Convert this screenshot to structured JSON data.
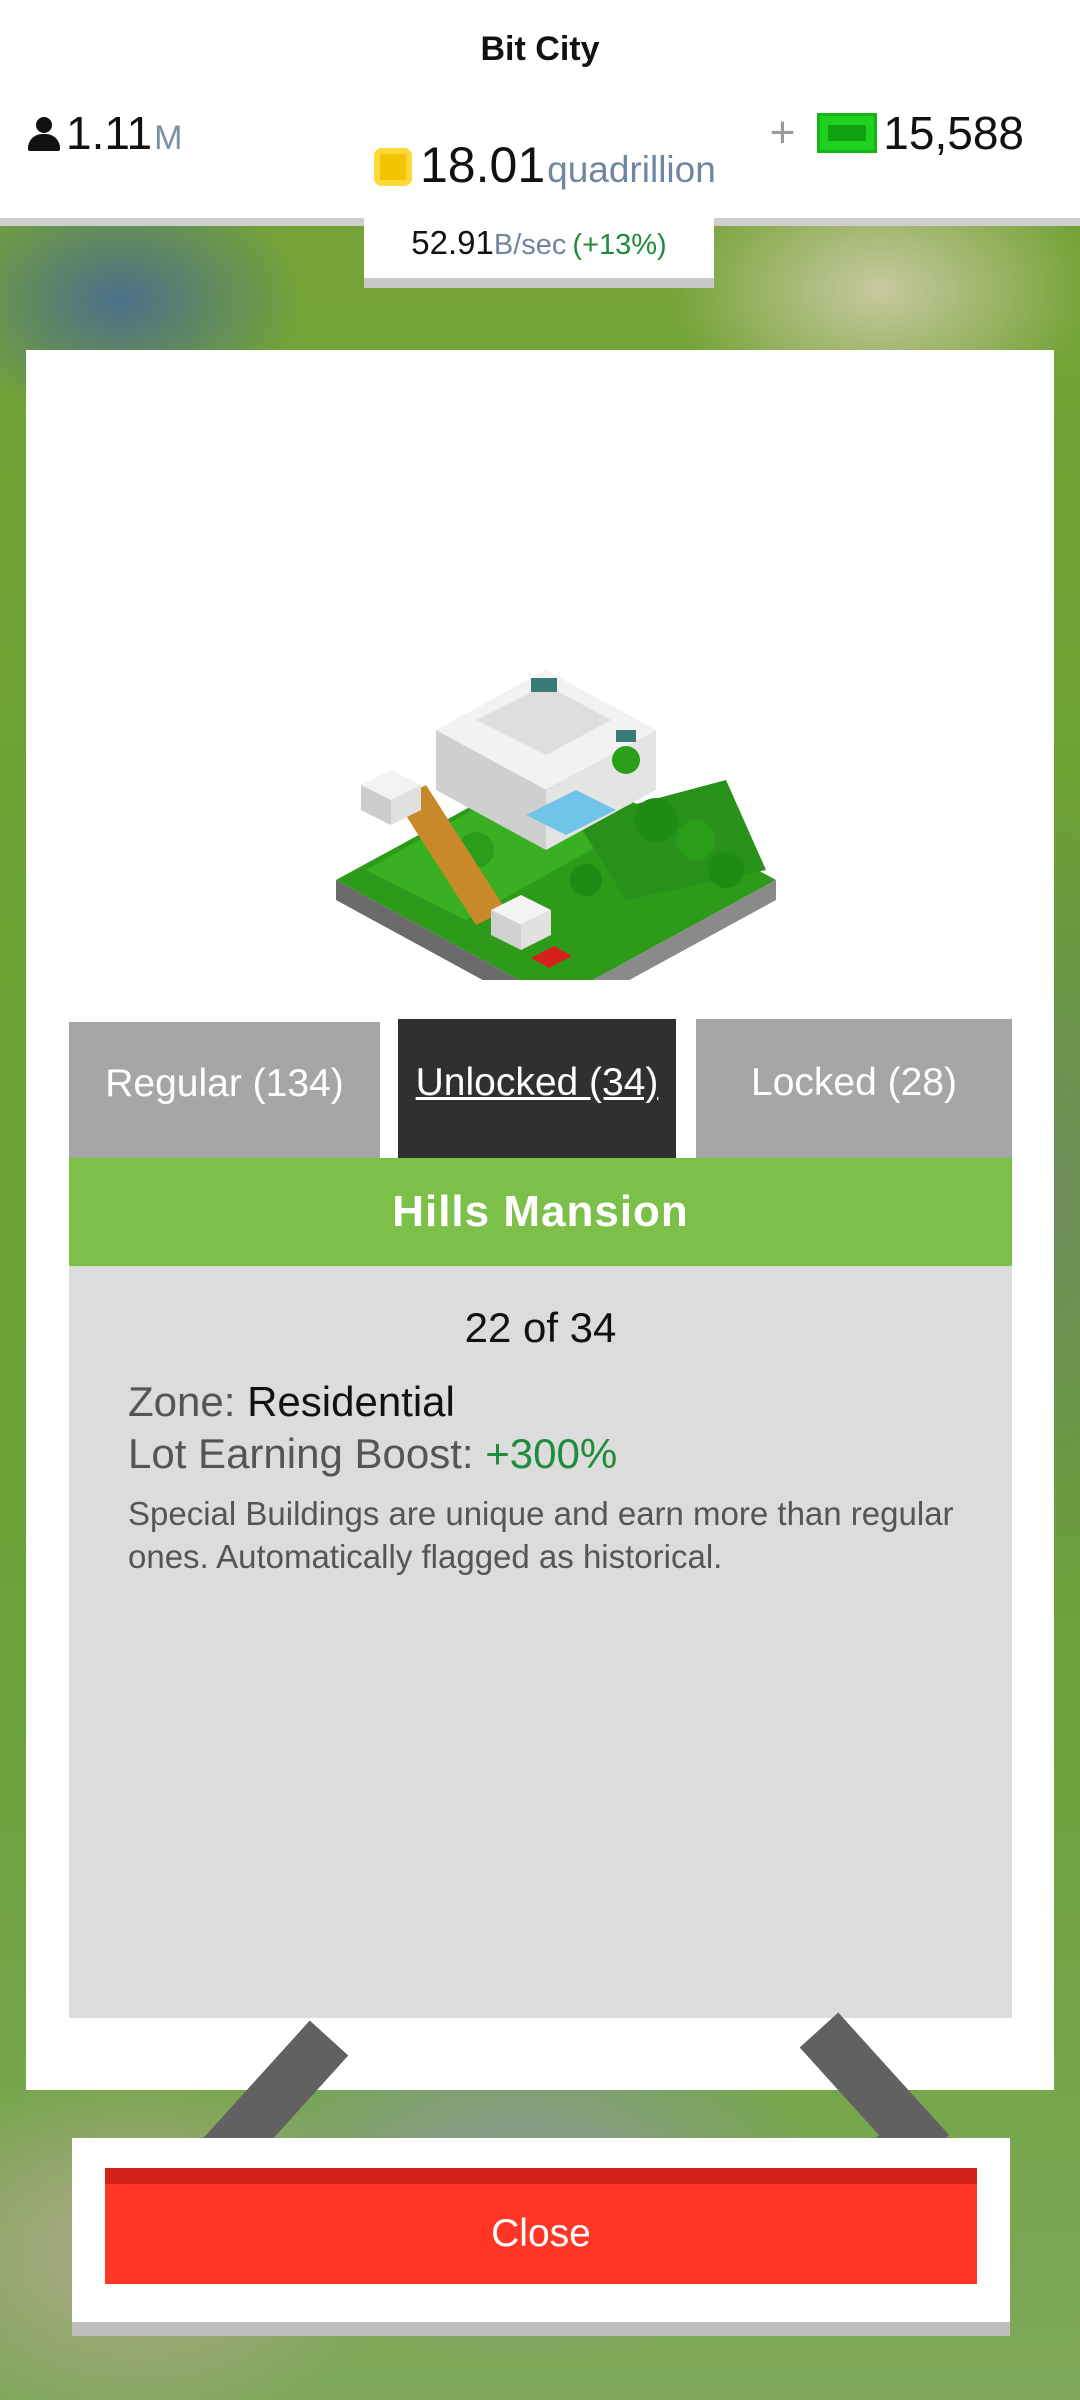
{
  "header": {
    "title": "Bit City",
    "population": {
      "value": "1.11",
      "unit": "M",
      "icon": "person-icon"
    },
    "coins": {
      "value": "18.01",
      "unit": "quadrillion",
      "icon": "coin-icon"
    },
    "cash": {
      "value": "15,588",
      "icon": "cash-icon",
      "plus_icon": "plus-icon"
    },
    "rate": {
      "value": "52.91",
      "unit": "B/sec",
      "change": "(+13%)"
    }
  },
  "tabs": [
    {
      "label": "Regular (134)",
      "active": false
    },
    {
      "label": "Unlocked (34)",
      "active": true
    },
    {
      "label": "Locked (28)",
      "active": false
    }
  ],
  "building": {
    "name": "Hills Mansion",
    "counter": "22 of 34",
    "zone_label": "Zone:",
    "zone_value": "Residential",
    "boost_label": "Lot Earning Boost:",
    "boost_value": "+300%",
    "description": "Special Buildings are unique and earn more than regular ones. Automatically flagged as historical."
  },
  "navigation": {
    "prev_icon": "chevron-left-icon",
    "next_icon": "chevron-right-icon"
  },
  "footer": {
    "close_label": "Close"
  },
  "colors": {
    "green_bar": "#7cc04a",
    "active_tab": "#303030",
    "inactive_tab": "#a6a6a6",
    "close_button": "#ff3626",
    "positive": "#1e8c3a"
  }
}
